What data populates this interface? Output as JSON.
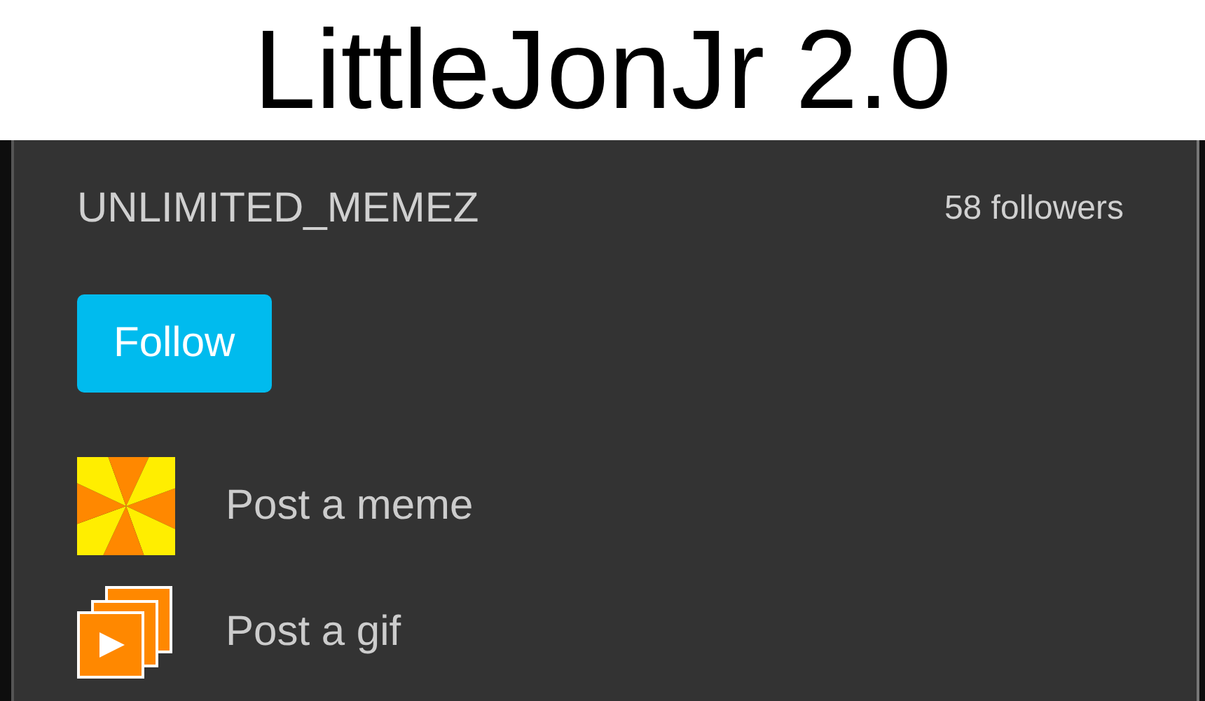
{
  "caption": "LittleJonJr 2.0",
  "stream": {
    "name": "UNLIMITED_MEMEZ",
    "followers": "58 followers",
    "follow_button": "Follow",
    "actions": [
      {
        "kind": "meme",
        "label": "Post a meme"
      },
      {
        "kind": "gif",
        "label": "Post a gif"
      }
    ]
  }
}
